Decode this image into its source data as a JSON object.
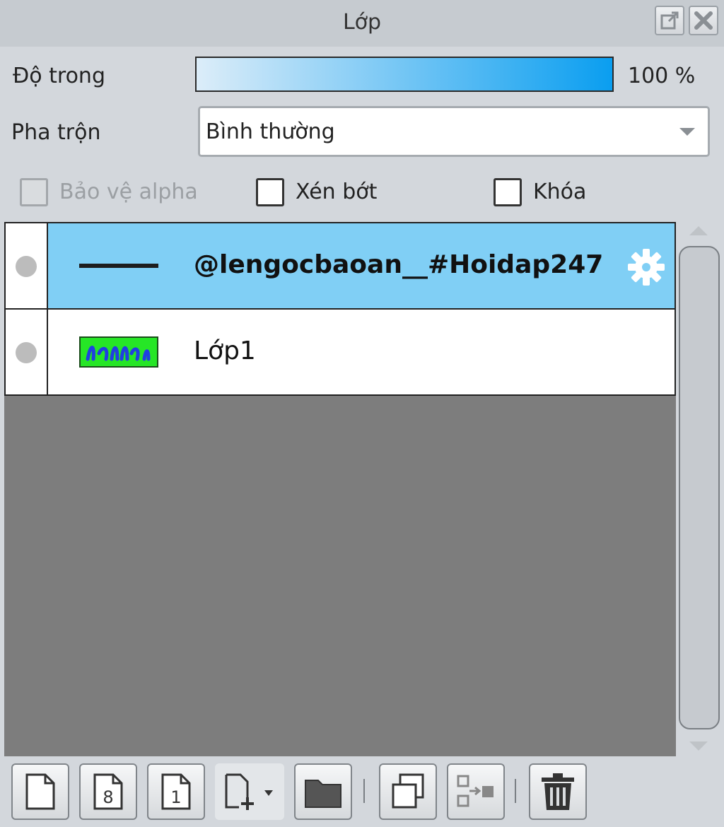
{
  "window": {
    "title": "Lớp"
  },
  "opacity": {
    "label": "Độ trong",
    "value_text": "100 %",
    "value": 100
  },
  "blend": {
    "label": "Pha trộn",
    "value": "Bình thường"
  },
  "options": {
    "alpha_protect": {
      "label": "Bảo vệ alpha",
      "checked": false,
      "enabled": false
    },
    "clip": {
      "label": "Xén bớt",
      "checked": false,
      "enabled": true
    },
    "lock": {
      "label": "Khóa",
      "checked": false,
      "enabled": true
    }
  },
  "layers": [
    {
      "name": "@lengocbaoan__#Hoidap247",
      "selected": true,
      "visible_icon": "dot-icon",
      "thumbnail": "line-thumbnail",
      "has_settings": true
    },
    {
      "name": "Lớp1",
      "selected": false,
      "visible_icon": "dot-icon",
      "thumbnail": "green-image-thumbnail",
      "has_settings": false
    }
  ],
  "toolbar": {
    "buttons": [
      {
        "icon": "new-page-icon"
      },
      {
        "icon": "new-8bit-layer-icon",
        "glyph": "8"
      },
      {
        "icon": "new-1bit-layer-icon",
        "glyph": "1"
      },
      {
        "icon": "add-layer-dropdown-icon"
      },
      {
        "icon": "folder-icon"
      },
      {
        "icon": "duplicate-layer-icon"
      },
      {
        "icon": "merge-layer-icon"
      },
      {
        "icon": "trash-icon"
      }
    ]
  },
  "colors": {
    "selected_row": "#80cff5",
    "opacity_fill_end": "#0a9ef0",
    "list_background": "#7d7d7d"
  }
}
